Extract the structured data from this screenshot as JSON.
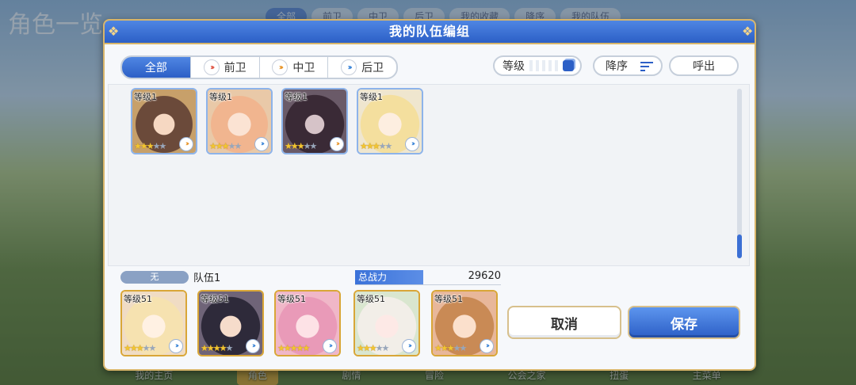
{
  "background": {
    "title": "角色一览",
    "tabs": [
      "全部",
      "前卫",
      "中卫",
      "后卫",
      "我的收藏",
      "降序",
      "我的队伍"
    ],
    "bottom_nav": [
      "我的主页",
      "角色",
      "剧情",
      "冒险",
      "公会之家",
      "扭蛋",
      "主菜单"
    ]
  },
  "dialog": {
    "title": "我的队伍编组",
    "filters": [
      {
        "label": "全部",
        "active": true
      },
      {
        "label": "前卫",
        "icon": "chevrons-red-icon"
      },
      {
        "label": "中卫",
        "icon": "chevrons-orange-icon"
      },
      {
        "label": "后卫",
        "icon": "chevrons-blue-icon"
      }
    ],
    "sort_level": "等级",
    "sort_order": "降序",
    "call": "呼出",
    "roster": [
      {
        "level": "等级1",
        "stars": 3,
        "color": "#6b4a3a"
      },
      {
        "level": "等级1",
        "stars": 3,
        "color": "#f1b58f"
      },
      {
        "level": "等级1",
        "stars": 3,
        "color": "#3a2a36"
      },
      {
        "level": "等级1",
        "stars": 3,
        "color": "#f4df9e"
      }
    ],
    "team": {
      "tag": "无",
      "name": "队伍1",
      "power_label": "总战力",
      "power_value": "29620",
      "members": [
        {
          "level": "等级51",
          "stars": 3,
          "color": "#f6e2b0"
        },
        {
          "level": "等级51",
          "stars": 4,
          "color": "#2e2a3a"
        },
        {
          "level": "等级51",
          "stars": 5,
          "color": "#e99ab8"
        },
        {
          "level": "等级51",
          "stars": 3,
          "color": "#f2eee8"
        },
        {
          "level": "等级51",
          "stars": 3,
          "color": "#c98a55"
        }
      ]
    },
    "cancel": "取消",
    "save": "保存"
  }
}
